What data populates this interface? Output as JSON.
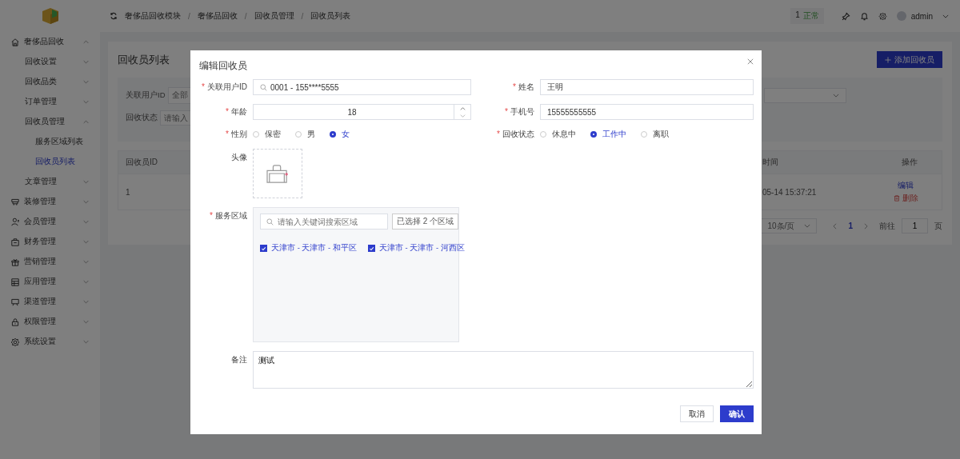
{
  "sidebar": {
    "items": [
      {
        "label": "奢侈品回收",
        "expanded": true,
        "children": [
          {
            "label": "回收设置",
            "expanded": false
          },
          {
            "label": "回收品类",
            "expanded": false
          },
          {
            "label": "订单管理",
            "expanded": false
          },
          {
            "label": "回收员管理",
            "expanded": true,
            "children": [
              {
                "label": "服务区域列表",
                "selected": false
              },
              {
                "label": "回收员列表",
                "selected": true
              }
            ]
          },
          {
            "label": "文章管理",
            "expanded": false
          }
        ]
      },
      {
        "label": "装修管理",
        "expanded": false
      },
      {
        "label": "会员管理",
        "expanded": false
      },
      {
        "label": "财务管理",
        "expanded": false
      },
      {
        "label": "营销管理",
        "expanded": false
      },
      {
        "label": "应用管理",
        "expanded": false
      },
      {
        "label": "渠道管理",
        "expanded": false
      },
      {
        "label": "权限管理",
        "expanded": false
      },
      {
        "label": "系统设置",
        "expanded": false
      }
    ]
  },
  "topbar": {
    "separator": "/",
    "breadcrumb": [
      "奢侈品回收模块",
      "奢侈品回收",
      "回收员管理",
      "回收员列表"
    ],
    "status_badge": {
      "count": "1",
      "label": "正常"
    },
    "user": "admin"
  },
  "page": {
    "title": "回收员列表",
    "add_button": "添加回收员",
    "filters": [
      {
        "label": "关联用户ID",
        "value": "全部"
      },
      {
        "label": "回收状态",
        "placeholder": "请输入"
      }
    ],
    "table": {
      "columns": [
        "回收员ID",
        "时间",
        "操作"
      ],
      "rows": [
        {
          "cells": [
            "1",
            "05-14 15:37:21"
          ],
          "actions": [
            "编辑",
            "删除"
          ]
        }
      ]
    },
    "pagination": {
      "page_size": "10条/页",
      "pages": [
        {
          "label": "1",
          "selected": true
        }
      ],
      "goto_label": "前往",
      "goto_value": "1",
      "page_unit": "页"
    }
  },
  "dialog": {
    "title": "编辑回收员",
    "required_mark": "*",
    "user_id": {
      "label": "关联用户ID",
      "required": true,
      "value": "0001 - 155****5555"
    },
    "name": {
      "label": "姓名",
      "required": true,
      "value": "王明"
    },
    "age": {
      "label": "年龄",
      "required": true,
      "value": "18"
    },
    "phone": {
      "label": "手机号",
      "required": true,
      "value": "15555555555"
    },
    "gender": {
      "label": "性别",
      "required": true,
      "options": [
        {
          "label": "保密",
          "selected": false
        },
        {
          "label": "男",
          "selected": false
        },
        {
          "label": "女",
          "selected": true
        }
      ]
    },
    "status": {
      "label": "回收状态",
      "required": true,
      "options": [
        {
          "label": "休息中",
          "selected": false
        },
        {
          "label": "工作中",
          "selected": true
        },
        {
          "label": "离职",
          "selected": false
        }
      ]
    },
    "avatar": {
      "label": "头像",
      "required": false
    },
    "service_area": {
      "label": "服务区域",
      "required": true,
      "search_placeholder": "请输入关键词搜索区域",
      "selected_count": "已选择 2 个区域",
      "areas": [
        {
          "label": "天津市 - 天津市 - 和平区",
          "checked": true
        },
        {
          "label": "天津市 - 天津市 - 河西区",
          "checked": true
        }
      ]
    },
    "remark": {
      "label": "备注",
      "required": false,
      "value": "测试"
    },
    "buttons": [
      {
        "label": "取消",
        "kind": "secondary"
      },
      {
        "label": "确认",
        "kind": "primary"
      }
    ]
  }
}
